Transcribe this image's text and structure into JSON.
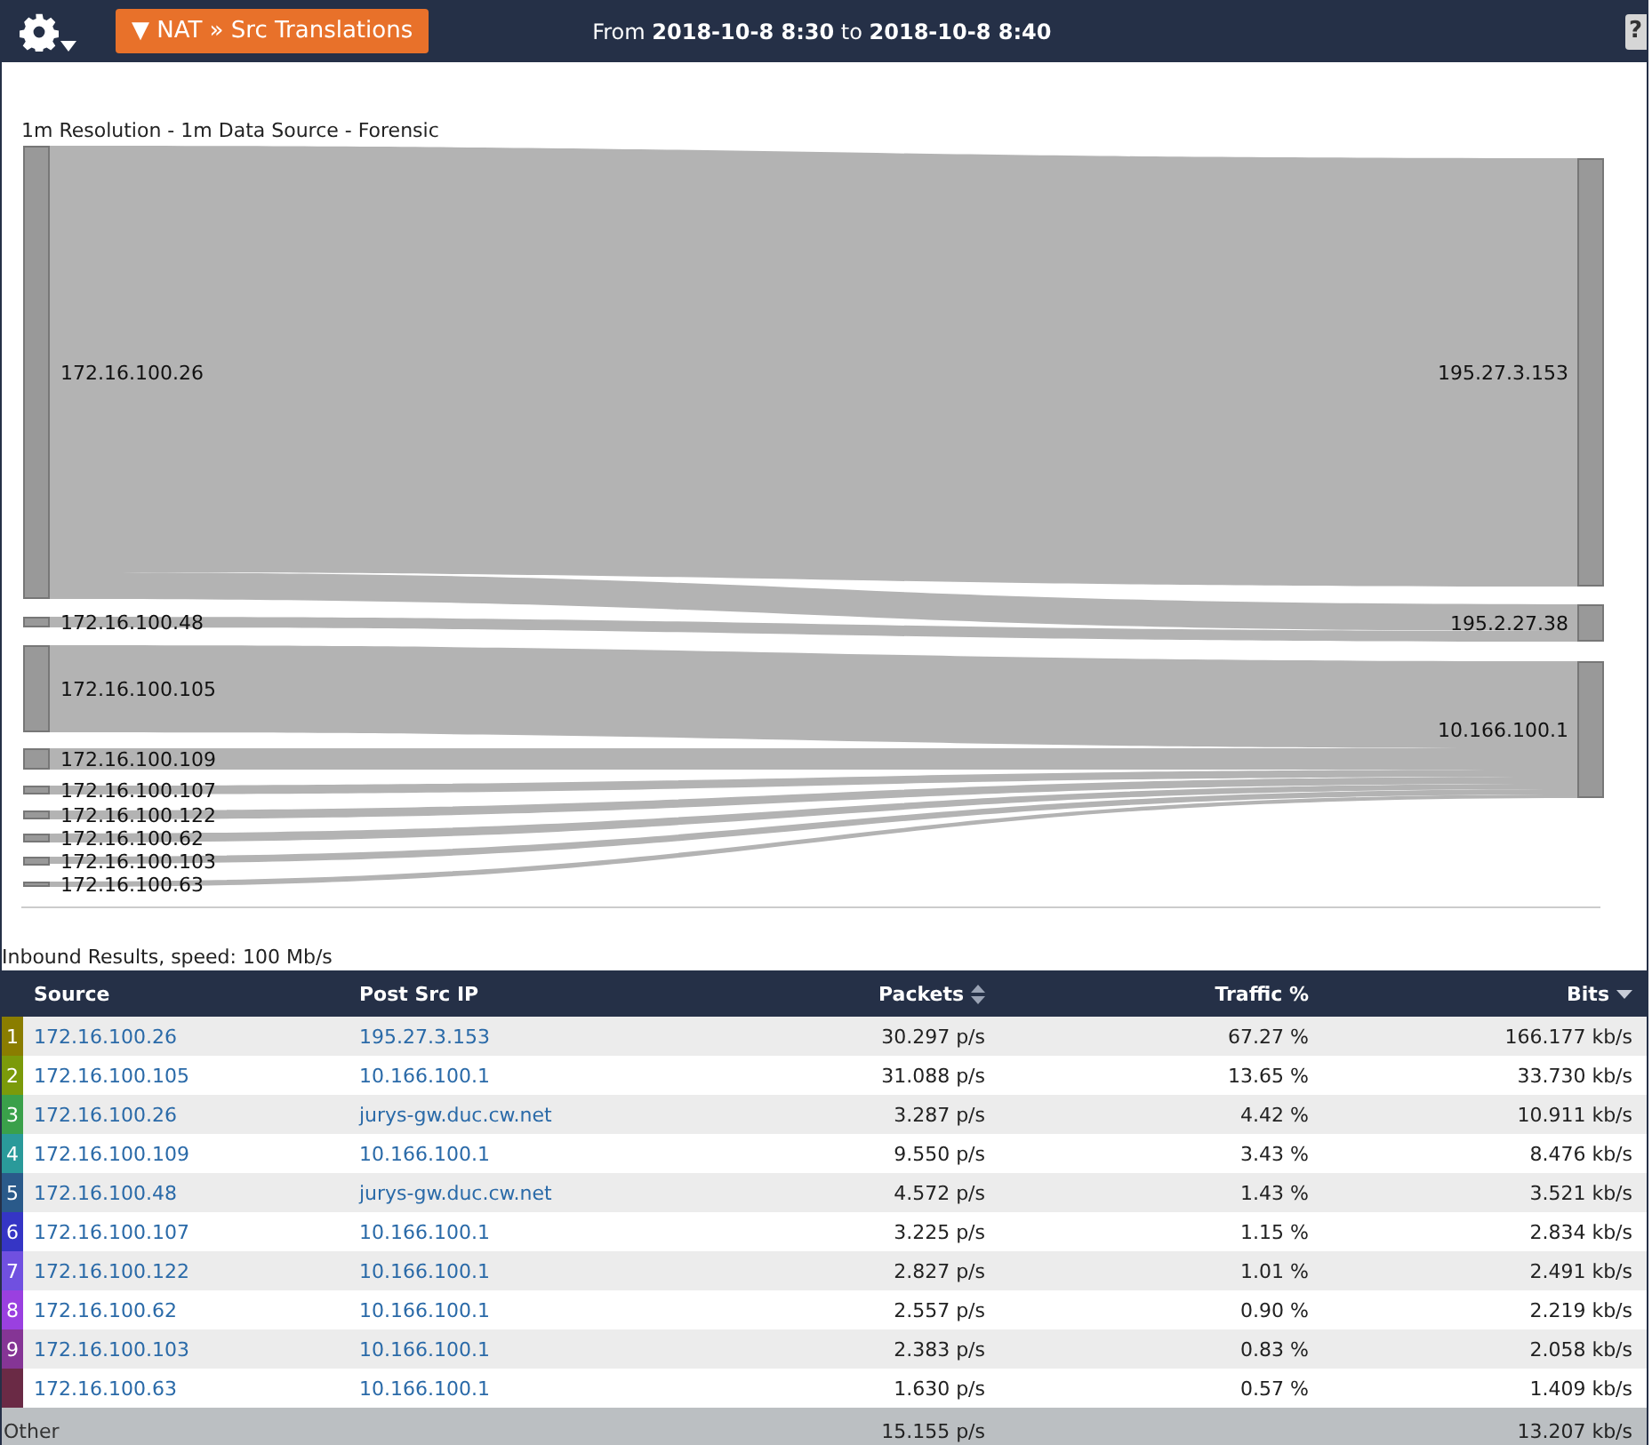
{
  "header": {
    "menu_button": "▼ NAT » Src Translations",
    "time_range": "From **2018-10-8 8:30** to **2018-10-8 8:40**",
    "help": "?"
  },
  "chart_caption": "1m Resolution - 1m Data Source - Forensic",
  "sankey": {
    "sources": [
      {
        "label": "172.16.100.26"
      },
      {
        "label": "172.16.100.48"
      },
      {
        "label": "172.16.100.105"
      },
      {
        "label": "172.16.100.109"
      },
      {
        "label": "172.16.100.107"
      },
      {
        "label": "172.16.100.122"
      },
      {
        "label": "172.16.100.62"
      },
      {
        "label": "172.16.100.103"
      },
      {
        "label": "172.16.100.63"
      }
    ],
    "targets": [
      {
        "label": "195.27.3.153"
      },
      {
        "label": "195.2.27.38"
      },
      {
        "label": "10.166.100.1"
      }
    ]
  },
  "results_caption": "Inbound Results, speed: 100 Mb/s",
  "table": {
    "columns": [
      {
        "label": "Source",
        "sortable": false,
        "sorted": false
      },
      {
        "label": "Post Src IP",
        "sortable": false,
        "sorted": false
      },
      {
        "label": "Packets",
        "sortable": true,
        "sorted": false
      },
      {
        "label": "Traffic %",
        "sortable": false,
        "sorted": false
      },
      {
        "label": "Bits",
        "sortable": true,
        "sorted": true
      }
    ],
    "rows": [
      {
        "rank": "1",
        "color": "#8a7d00",
        "source": "172.16.100.26",
        "post_src_ip": "195.27.3.153",
        "packets": "30.297 p/s",
        "traffic": "67.27 %",
        "bits": "166.177 kb/s"
      },
      {
        "rank": "2",
        "color": "#7b9a0a",
        "source": "172.16.100.105",
        "post_src_ip": "10.166.100.1",
        "packets": "31.088 p/s",
        "traffic": "13.65 %",
        "bits": "33.730 kb/s"
      },
      {
        "rank": "3",
        "color": "#3aa04a",
        "source": "172.16.100.26",
        "post_src_ip": "jurys-gw.duc.cw.net",
        "packets": "3.287 p/s",
        "traffic": "4.42 %",
        "bits": "10.911 kb/s"
      },
      {
        "rank": "4",
        "color": "#2a9a9a",
        "source": "172.16.100.109",
        "post_src_ip": "10.166.100.1",
        "packets": "9.550 p/s",
        "traffic": "3.43 %",
        "bits": "8.476 kb/s"
      },
      {
        "rank": "5",
        "color": "#2a5a8a",
        "source": "172.16.100.48",
        "post_src_ip": "jurys-gw.duc.cw.net",
        "packets": "4.572 p/s",
        "traffic": "1.43 %",
        "bits": "3.521 kb/s"
      },
      {
        "rank": "6",
        "color": "#3535c5",
        "source": "172.16.100.107",
        "post_src_ip": "10.166.100.1",
        "packets": "3.225 p/s",
        "traffic": "1.15 %",
        "bits": "2.834 kb/s"
      },
      {
        "rank": "7",
        "color": "#7050e0",
        "source": "172.16.100.122",
        "post_src_ip": "10.166.100.1",
        "packets": "2.827 p/s",
        "traffic": "1.01 %",
        "bits": "2.491 kb/s"
      },
      {
        "rank": "8",
        "color": "#9a40e0",
        "source": "172.16.100.62",
        "post_src_ip": "10.166.100.1",
        "packets": "2.557 p/s",
        "traffic": "0.90 %",
        "bits": "2.219 kb/s"
      },
      {
        "rank": "9",
        "color": "#853595",
        "source": "172.16.100.103",
        "post_src_ip": "10.166.100.1",
        "packets": "2.383 p/s",
        "traffic": "0.83 %",
        "bits": "2.058 kb/s"
      },
      {
        "color": "#6a2a45",
        "source": "172.16.100.63",
        "post_src_ip": "10.166.100.1",
        "packets": "1.630 p/s",
        "traffic": "0.57 %",
        "bits": "1.409 kb/s"
      }
    ],
    "other": {
      "label": "Other",
      "packets": "15.155 p/s",
      "bits": "13.207 kb/s"
    }
  }
}
